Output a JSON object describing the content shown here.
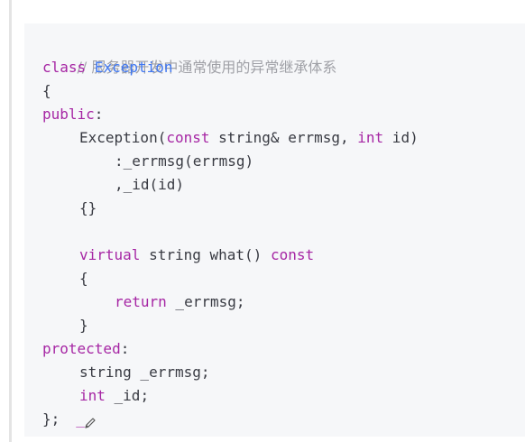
{
  "code": {
    "comment": "// 服务器开发中通常使用的异常继承体系",
    "class_kw": "class",
    "class_name": "Exception",
    "open_brace": "{",
    "public_kw": "public",
    "colon": ":",
    "ctor_name": "Exception(",
    "const_kw": "const",
    "ctor_params_a": " string& errmsg, ",
    "int_kw": "int",
    "ctor_params_b": " id)",
    "init1": ":_errmsg(errmsg)",
    "init2": ",_id(id)",
    "empty_body": "{}",
    "virtual_kw": "virtual",
    "what_sig": " string what() ",
    "const_kw2": "const",
    "fn_open": "{",
    "return_kw": "return",
    "return_expr": " _errmsg;",
    "fn_close": "}",
    "protected_kw": "protected",
    "member1": "string _errmsg;",
    "int_kw2": "int",
    "member2": " _id;",
    "class_close": "};",
    "cursor": "_"
  },
  "colors": {
    "keyword": "#a626a4",
    "type": "#4078f2",
    "comment": "#a0a1a7",
    "background": "#f6f7f9"
  },
  "icons": [
    "pencil-icon"
  ]
}
